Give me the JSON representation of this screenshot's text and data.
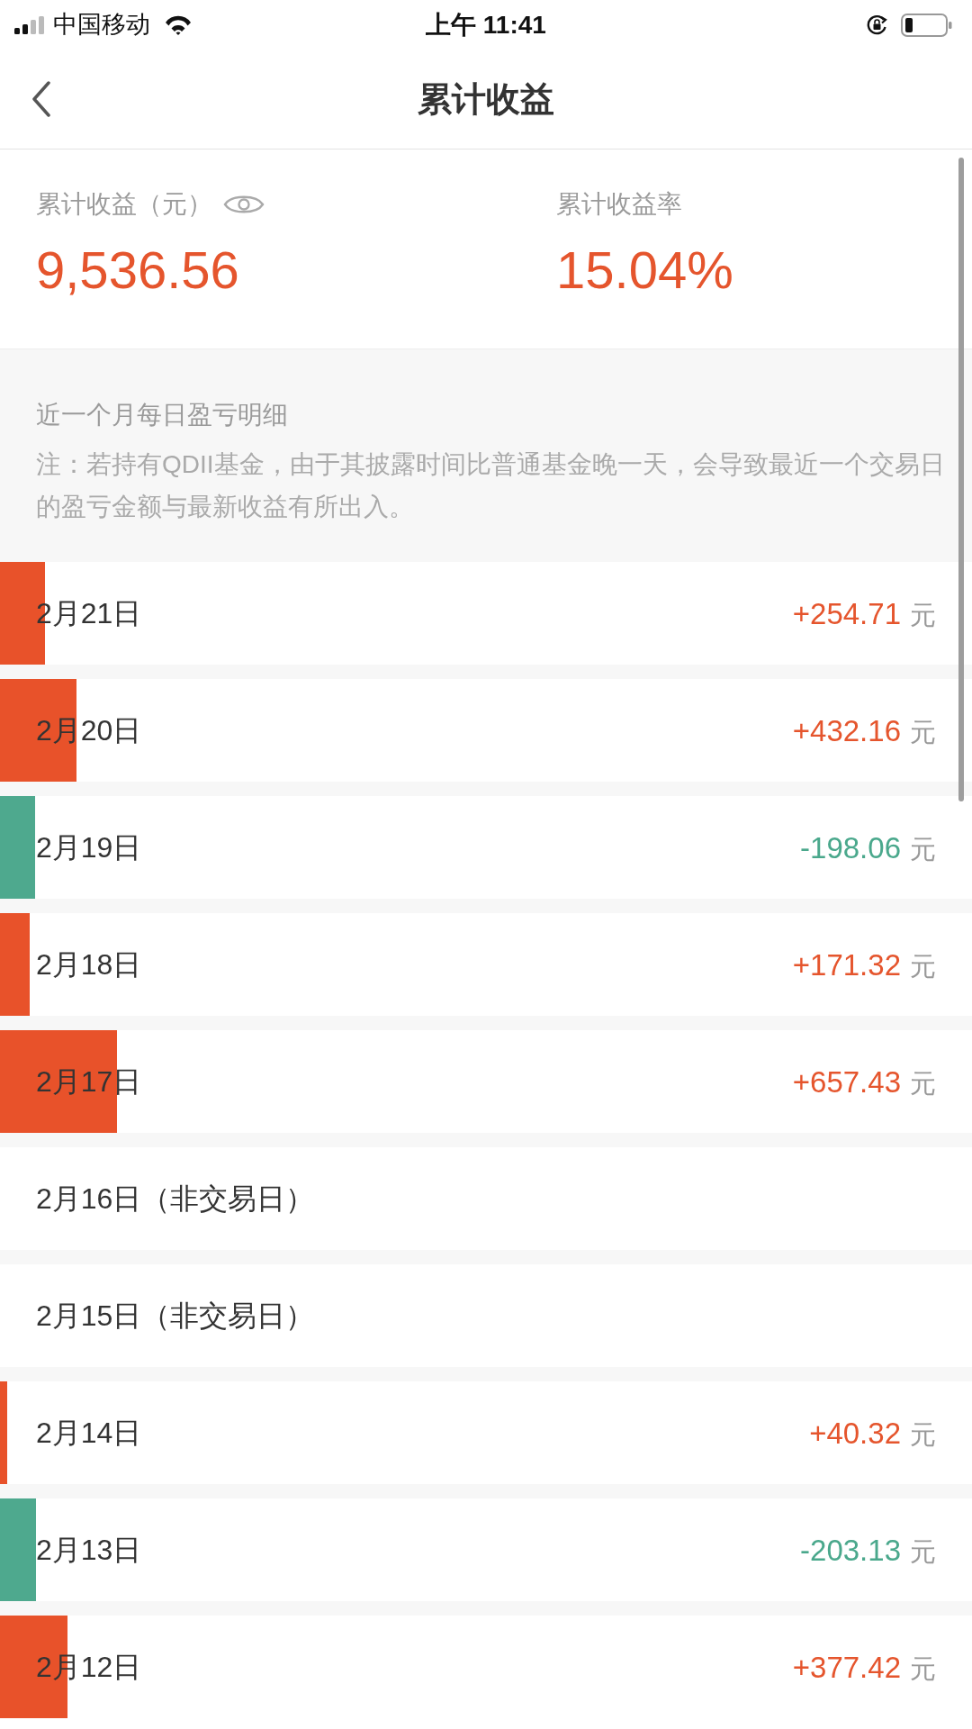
{
  "status_bar": {
    "carrier": "中国移动",
    "time": "上午 11:41"
  },
  "nav": {
    "title": "累计收益"
  },
  "summary": {
    "total": {
      "label": "累计收益（元）",
      "value": "9,536.56"
    },
    "rate": {
      "label": "累计收益率",
      "value": "15.04%"
    }
  },
  "detail": {
    "title": "近一个月每日盈亏明细",
    "note": "注：若持有QDII基金，由于其披露时间比普通基金晚一天，会导致最近一个交易日的盈亏金额与最新收益有所出入。"
  },
  "rows": [
    {
      "date": "2月21日",
      "kind": "gain",
      "amount": "+254.71",
      "unit": "元",
      "level": 0.046
    },
    {
      "date": "2月20日",
      "kind": "gain",
      "amount": "+432.16",
      "unit": "元",
      "level": 0.079
    },
    {
      "date": "2月19日",
      "kind": "loss",
      "amount": "-198.06",
      "unit": "元",
      "level": 0.036
    },
    {
      "date": "2月18日",
      "kind": "gain",
      "amount": "+171.32",
      "unit": "元",
      "level": 0.031
    },
    {
      "date": "2月17日",
      "kind": "gain",
      "amount": "+657.43",
      "unit": "元",
      "level": 0.12
    },
    {
      "date": "2月16日（非交易日）",
      "kind": "closed"
    },
    {
      "date": "2月15日（非交易日）",
      "kind": "closed"
    },
    {
      "date": "2月14日",
      "kind": "gain",
      "amount": "+40.32",
      "unit": "元",
      "level": 0.007
    },
    {
      "date": "2月13日",
      "kind": "loss",
      "amount": "-203.13",
      "unit": "元",
      "level": 0.037
    },
    {
      "date": "2月12日",
      "kind": "gain",
      "amount": "+377.42",
      "unit": "元",
      "level": 0.069
    }
  ]
}
